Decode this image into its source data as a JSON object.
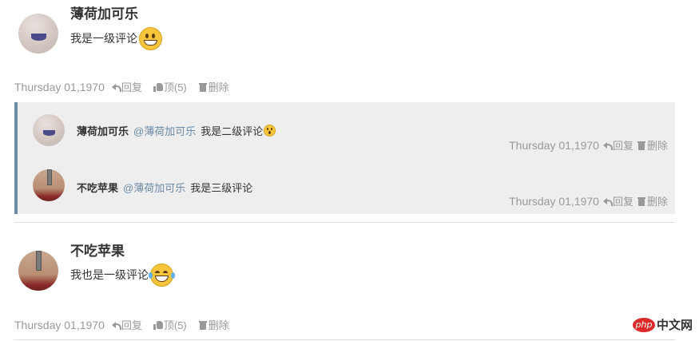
{
  "comments": [
    {
      "author": "薄荷加可乐",
      "text": "我是一级评论",
      "emoji": "grinning-emoji",
      "date": "Thursday 01,1970",
      "reply_label": "回复",
      "like_label": "顶(5)",
      "delete_label": "删除"
    },
    {
      "author": "不吃苹果",
      "text": "我也是一级评论",
      "emoji": "laughing-tears-emoji",
      "date": "Thursday 01,1970",
      "reply_label": "回复",
      "like_label": "顶(5)",
      "delete_label": "删除"
    }
  ],
  "replies": [
    {
      "author": "薄荷加可乐",
      "mention": "@薄荷加可乐",
      "text": "我是二级评论",
      "emoji": "surprised-emoji",
      "date": "Thursday 01,1970",
      "reply_label": "回复",
      "delete_label": "删除"
    },
    {
      "author": "不吃苹果",
      "mention": "@薄荷加可乐",
      "text": "我是三级评论",
      "date": "Thursday 01,1970",
      "reply_label": "回复",
      "delete_label": "删除"
    }
  ],
  "watermark": {
    "logo": "php",
    "text": "中文网"
  },
  "colors": {
    "reply_border": "#6a8aa6",
    "reply_bg": "#eeeeee",
    "mention": "#6a8aa6",
    "meta": "#999999"
  }
}
